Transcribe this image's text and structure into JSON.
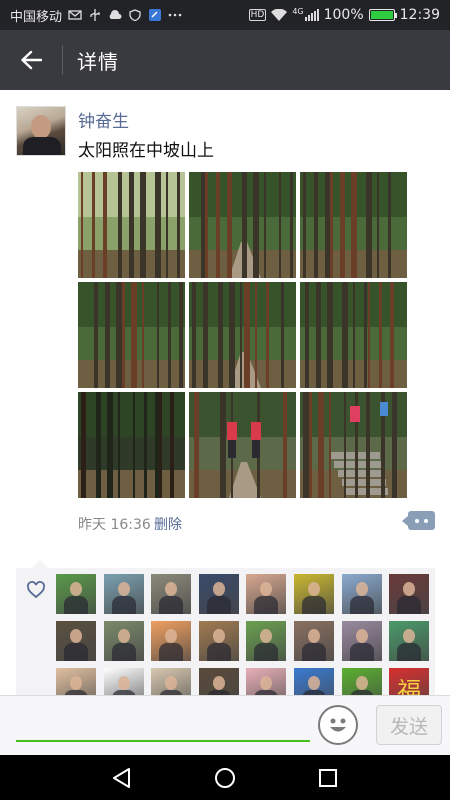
{
  "status_bar": {
    "carrier": "中国移动",
    "hd_badge": "HD",
    "network": "4G",
    "battery_text": "100%",
    "battery_level": 1.0,
    "time": "12:39",
    "icons": [
      "mail-icon",
      "usb-icon",
      "cloud-icon",
      "shield-icon",
      "app-icon",
      "more-icon",
      "wifi-icon",
      "signal-icon",
      "battery-icon"
    ]
  },
  "title_bar": {
    "back_icon": "back-arrow-icon",
    "title": "详情"
  },
  "post": {
    "author": "钟奋生",
    "text": "太阳照在中坡山上",
    "photos": [
      {
        "scene": "forest-sunlight"
      },
      {
        "scene": "forest-path"
      },
      {
        "scene": "forest-trees"
      },
      {
        "scene": "forest-trees"
      },
      {
        "scene": "forest-path"
      },
      {
        "scene": "forest-trees"
      },
      {
        "scene": "forest-dark"
      },
      {
        "scene": "hikers-path"
      },
      {
        "scene": "stone-steps"
      }
    ],
    "time": "昨天 16:36",
    "delete_label": "删除",
    "comment_icon": "comment-icon"
  },
  "likes": {
    "heart_icon": "heart-icon",
    "avatars": [
      {
        "name": "like-avatar-1"
      },
      {
        "name": "like-avatar-2"
      },
      {
        "name": "like-avatar-3"
      },
      {
        "name": "like-avatar-4"
      },
      {
        "name": "like-avatar-5"
      },
      {
        "name": "like-avatar-6"
      },
      {
        "name": "like-avatar-7"
      },
      {
        "name": "like-avatar-8"
      },
      {
        "name": "like-avatar-9"
      },
      {
        "name": "like-avatar-10"
      },
      {
        "name": "like-avatar-11"
      },
      {
        "name": "like-avatar-12"
      },
      {
        "name": "like-avatar-13"
      },
      {
        "name": "like-avatar-14"
      },
      {
        "name": "like-avatar-15"
      },
      {
        "name": "like-avatar-16"
      },
      {
        "name": "like-avatar-17"
      },
      {
        "name": "like-avatar-18"
      },
      {
        "name": "like-avatar-19"
      },
      {
        "name": "like-avatar-20"
      },
      {
        "name": "like-avatar-21"
      },
      {
        "name": "like-avatar-22"
      },
      {
        "name": "like-avatar-23"
      },
      {
        "name": "like-avatar-24"
      }
    ],
    "avatar_characters": {
      "like-avatar-24": "福"
    }
  },
  "input_bar": {
    "input_value": "",
    "emoji_icon": "emoji-icon",
    "send_label": "发送"
  },
  "nav_bar": {
    "icons": [
      "nav-back-icon",
      "nav-home-icon",
      "nav-recents-icon"
    ]
  },
  "colors": {
    "title_bar": "#393a3f",
    "link": "#576b95",
    "input_underline": "#45c01a",
    "comment_button": "#8b9eb8"
  }
}
